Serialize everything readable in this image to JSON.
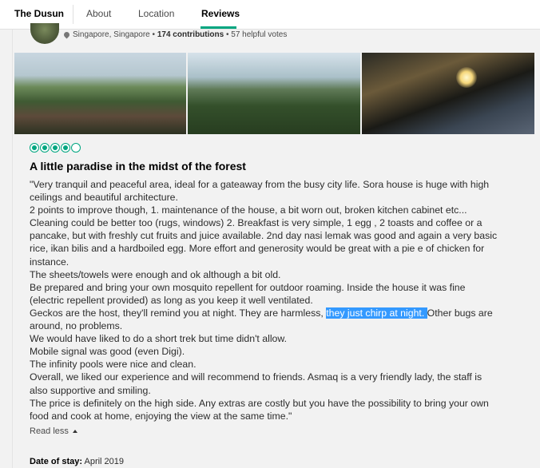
{
  "nav": {
    "brand": "The Dusun",
    "tabs": [
      "About",
      "Location",
      "Reviews"
    ],
    "active_tab": "Reviews"
  },
  "reviewer": {
    "location": "Singapore, Singapore",
    "separator": "•",
    "contributions": "174 contributions",
    "helpful": "57 helpful votes"
  },
  "photos": [
    "forest-view-photo",
    "hills-forest-photo",
    "night-terrace-photo"
  ],
  "review": {
    "rating": 4,
    "rating_max": 5,
    "title": "A little paradise in the midst of the forest",
    "lines": [
      "\"Very tranquil and peaceful area, ideal for a gateaway from the busy city life. Sora house is huge with high",
      "ceilings and beautiful architecture.",
      "2 points to improve though, 1. maintenance of the house, a bit worn out, broken kitchen cabinet etc...",
      "Cleaning could be better too (rugs, windows) 2. Breakfast is very simple, 1 egg , 2 toasts and coffee or a",
      "pancake, but with freshly cut fruits and juice available. 2nd day nasi lemak was good and again a very basic",
      "rice, ikan bilis and a hardboiled egg. More effort and generosity would be great with a pie e of chicken for",
      "instance.",
      "The sheets/towels were enough and ok although a bit old.",
      "Be prepared and bring your own mosquito repellent for outdoor roaming. Inside the house it was fine",
      "(electric repellent provided) as long as you keep it well ventilated.",
      {
        "pre": "Geckos are the host, they'll remind you at night. They are harmless, ",
        "highlight": "they just chirp at night. ",
        "post": "Other bugs are"
      },
      "around, no problems.",
      "We would have liked to do a short trek but time didn't allow.",
      "Mobile signal was good (even Digi).",
      "The infinity pools were nice and clean.",
      "Overall, we liked our experience and will recommend to friends. Asmaq is a very friendly lady, the staff is",
      "also supportive and smiling.",
      "The price is definitely on the high side. Any extras are costly but you have the possibility to bring your own",
      "food and cook at home, enjoying the view at the same time.\""
    ],
    "read_less": "Read less",
    "date_label": "Date of stay:",
    "date_value": "April 2019"
  },
  "colors": {
    "accent": "#00a680",
    "selection": "#3399ff"
  }
}
